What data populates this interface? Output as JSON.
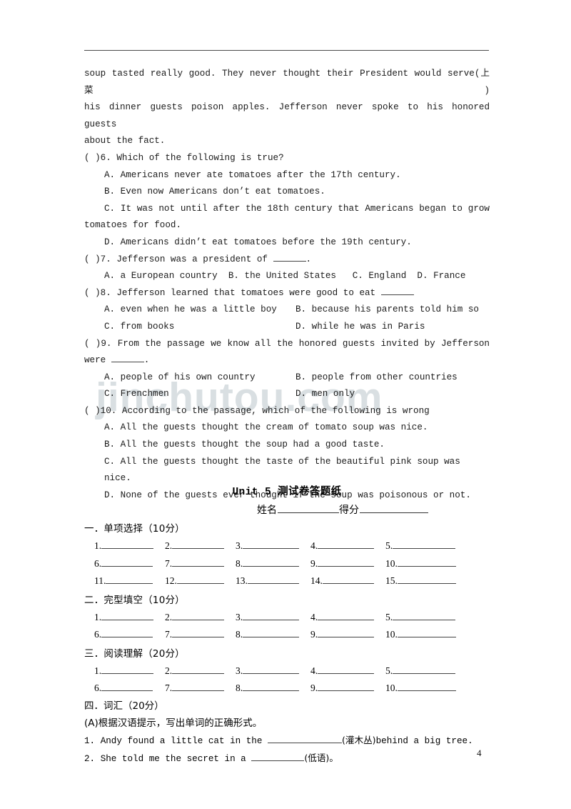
{
  "document": {
    "page_number": "4",
    "watermark": "jinchutou.com"
  },
  "passage": {
    "line1": "soup tasted really good. They never thought their President would serve(上菜)",
    "line2": "his dinner guests poison apples. Jefferson never spoke to his honored guests",
    "line3": "about the fact."
  },
  "questions": [
    {
      "marker": "(    )6.",
      "stem": "Which of the following is true?",
      "options": [
        "A. Americans never ate tomatoes after the 17th century.",
        "B. Even now Americans don’t eat tomatoes.",
        "C. It was not until after the 18th century that Americans began to grow",
        "tomatoes for food.",
        "D. Americans didn’t eat tomatoes before the 19th century."
      ]
    },
    {
      "marker": "(    )7.",
      "stem_pre": "Jefferson was a president of ",
      "stem_post": ".",
      "options_inline": [
        "A. a European country",
        "B. the United States",
        "C. England",
        "D. France"
      ]
    },
    {
      "marker": "(    )8.",
      "stem_pre": "Jefferson learned that tomatoes were good to eat ",
      "stem_post": "",
      "options_grid": [
        [
          "A. even when he was a little boy",
          "B. because his parents told him so"
        ],
        [
          "C. from books",
          "D. while he was in Paris"
        ]
      ]
    },
    {
      "marker": "(    )9.",
      "stem": "From the passage we know all the honored guests invited by Jefferson",
      "stem_cont_pre": "were ",
      "stem_cont_post": ".",
      "options_grid": [
        [
          "A. people of his own country",
          "B. people from other countries"
        ],
        [
          "C. Frenchmen",
          "D. men only"
        ]
      ]
    },
    {
      "marker": "(    )10.",
      "stem": "According to the passage, which of the following is wrong",
      "options": [
        "A. All the guests thought the cream of tomato soup was nice.",
        "B. All the guests thought the soup had a good taste.",
        "C. All the guests thought the taste of the beautiful pink soup was nice.",
        "D. None of the guests ever thought if the soup was poisonous or not."
      ]
    }
  ],
  "answer_sheet": {
    "title": "Unit 5 测试卷答题纸",
    "name_label": "姓名",
    "score_label": "得分",
    "sections": [
      {
        "heading": "一．单项选择（10分）",
        "rows": [
          [
            "1.",
            "2.",
            "3.",
            "4.",
            "5."
          ],
          [
            "6.",
            "7.",
            "8.",
            "9.",
            "10."
          ],
          [
            "11.",
            "12.",
            "13.",
            "14.",
            "15."
          ]
        ]
      },
      {
        "heading": "二．完型填空（10分）",
        "rows": [
          [
            "1.",
            "2.",
            "3.",
            "4.",
            "5."
          ],
          [
            "6.",
            "7.",
            "8.",
            "9.",
            "10."
          ]
        ]
      },
      {
        "heading": "三．阅读理解（20分）",
        "rows": [
          [
            "1.",
            "2.",
            "3.",
            "4.",
            "5."
          ],
          [
            "6.",
            "7.",
            "8.",
            "9.",
            "10."
          ]
        ]
      }
    ],
    "vocabulary": {
      "heading": "四．词汇（20分）",
      "subheading": "(A)根据汉语提示，写出单词的正确形式。",
      "items": [
        {
          "number": "1.",
          "pre": "Andy found a little cat in the ",
          "hint": "(灌木丛)",
          "post": "behind a big tree."
        },
        {
          "number": "2.",
          "pre": "She told me the secret in a ",
          "hint": "(低语)",
          "post": "。"
        }
      ]
    }
  }
}
